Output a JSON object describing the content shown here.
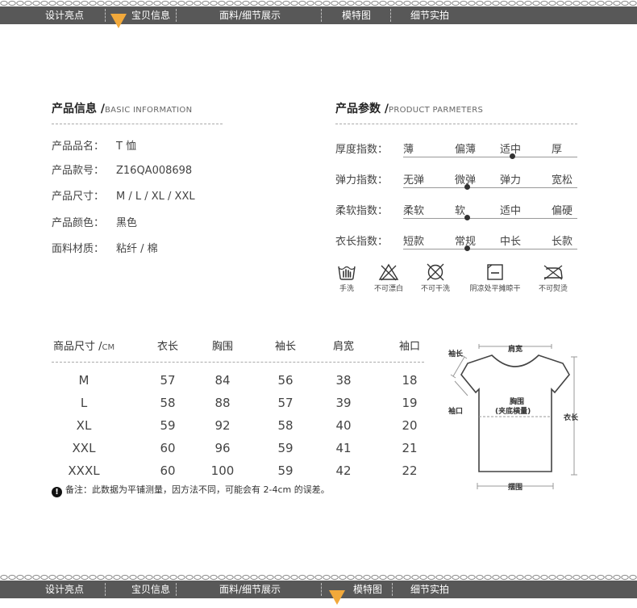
{
  "nav": {
    "tabs": [
      "设计亮点",
      "宝贝信息",
      "面料/细节展示",
      "模特图",
      "细节实拍"
    ],
    "accent": "#f2a93b",
    "bar_color": "#585858"
  },
  "product_info": {
    "title": "产品信息 /",
    "subtitle": "BASIC INFORMATION",
    "rows": [
      {
        "key": "产品品名：",
        "value": "T 恤"
      },
      {
        "key": "产品款号：",
        "value": "Z16QA008698"
      },
      {
        "key": "产品尺寸：",
        "value": "M / L / XL / XXL"
      },
      {
        "key": "产品颜色：",
        "value": "黑色"
      },
      {
        "key": "面料材质：",
        "value": "粘纤 / 棉"
      }
    ]
  },
  "product_params": {
    "title": "产品参数 /",
    "subtitle": "PRODUCT PARMETERS",
    "rows": [
      {
        "key": "厚度指数：",
        "options": [
          "薄",
          "偏薄",
          "适中",
          "厚"
        ],
        "selected": 2
      },
      {
        "key": "弹力指数：",
        "options": [
          "无弹",
          "微弹",
          "弹力",
          "宽松"
        ],
        "selected": 1
      },
      {
        "key": "柔软指数：",
        "options": [
          "柔软",
          "软",
          "适中",
          "偏硬"
        ],
        "selected": 1
      },
      {
        "key": "衣长指数：",
        "options": [
          "短款",
          "常规",
          "中长",
          "长款"
        ],
        "selected": 1
      }
    ]
  },
  "care_icons": [
    {
      "icon": "hand-wash-icon",
      "label": "手洗"
    },
    {
      "icon": "no-bleach-icon",
      "label": "不可漂白"
    },
    {
      "icon": "no-dry-clean-icon",
      "label": "不可干洗"
    },
    {
      "icon": "shade-dry-flat-icon",
      "label": "阴凉处平摊晾干"
    },
    {
      "icon": "no-iron-icon",
      "label": "不可熨烫"
    }
  ],
  "size_table": {
    "title": "商品尺寸 /",
    "unit": "CM",
    "columns": [
      "衣长",
      "胸围",
      "袖长",
      "肩宽",
      "袖口"
    ],
    "rows": [
      {
        "size": "M",
        "values": [
          "57",
          "84",
          "56",
          "38",
          "18"
        ]
      },
      {
        "size": "L",
        "values": [
          "58",
          "88",
          "57",
          "39",
          "19"
        ]
      },
      {
        "size": "XL",
        "values": [
          "59",
          "92",
          "58",
          "40",
          "20"
        ]
      },
      {
        "size": "XXL",
        "values": [
          "60",
          "96",
          "59",
          "41",
          "21"
        ]
      },
      {
        "size": "XXXL",
        "values": [
          "60",
          "100",
          "59",
          "42",
          "22"
        ]
      }
    ],
    "note": "备注：此数据为平铺测量，因方法不同，可能会有 2-4cm 的误差。"
  },
  "diagram_labels": {
    "shoulder": "肩宽",
    "sleeve_length": "袖长",
    "cuff": "袖口",
    "chest_line1": "胸围",
    "chest_line2": "(夹底横量)",
    "length": "衣长",
    "hem": "摆围"
  }
}
